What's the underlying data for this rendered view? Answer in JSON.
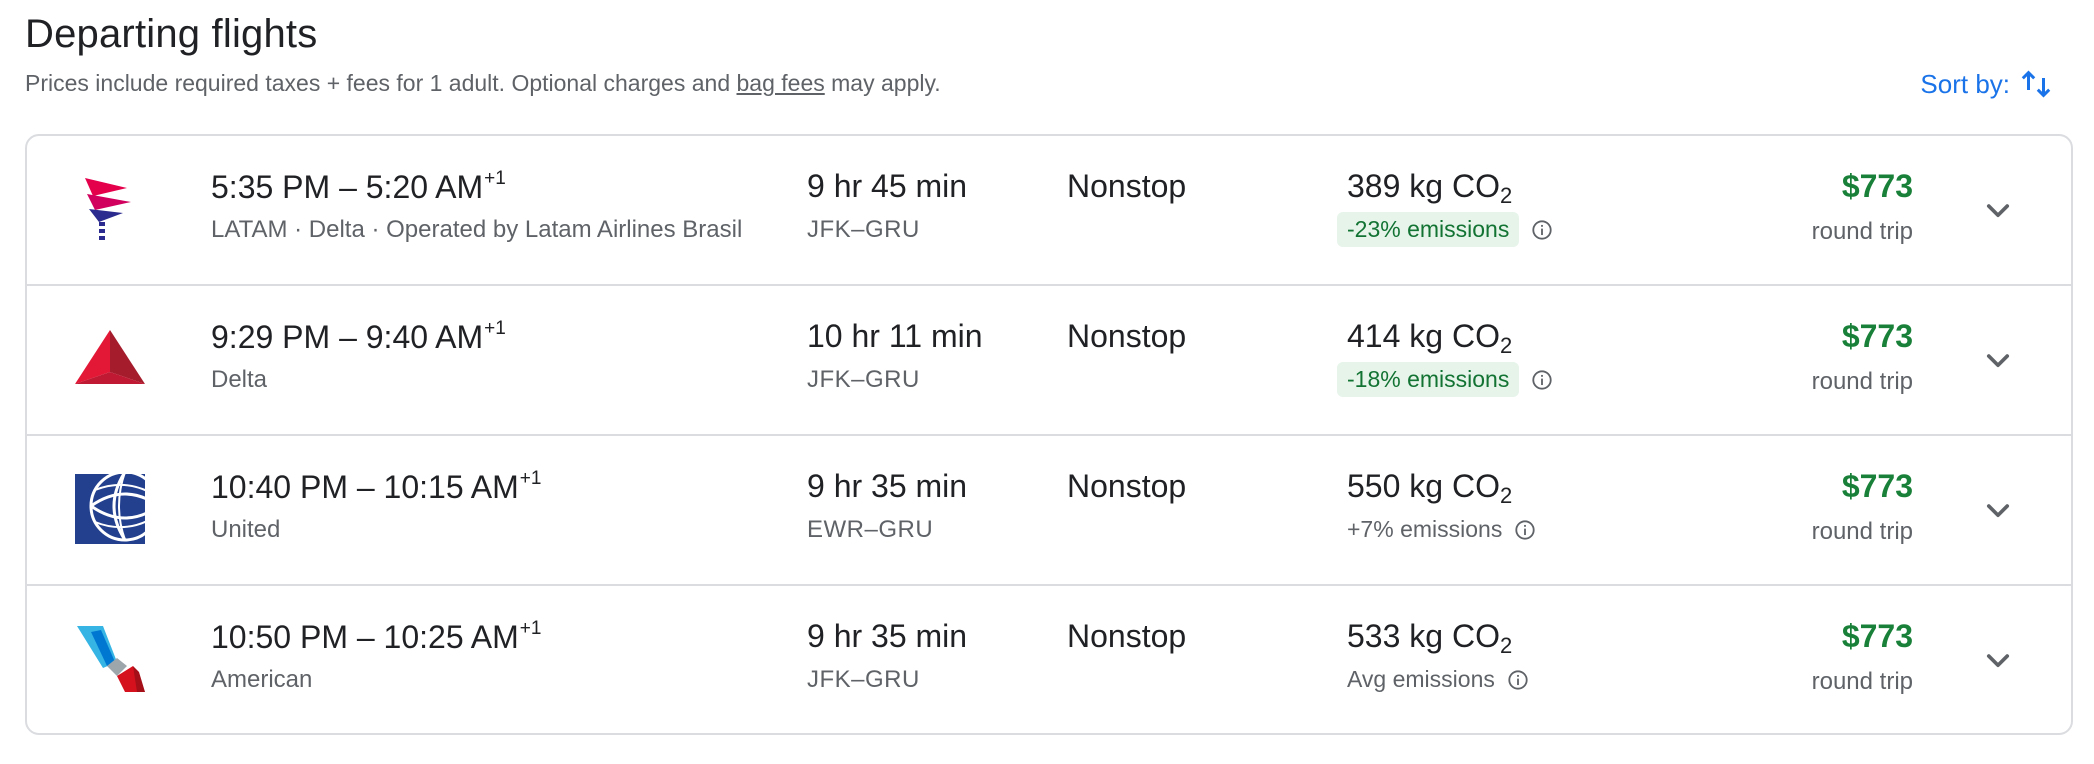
{
  "header": {
    "title": "Departing flights",
    "subtitle_prefix": "Prices include required taxes + fees for 1 adult. Optional charges and ",
    "subtitle_link": "bag fees",
    "subtitle_suffix": " may apply.",
    "sort_label": "Sort by:",
    "sort_icon": "swap-vert-icon"
  },
  "colors": {
    "accent_blue": "#1a73e8",
    "price_green": "#188038",
    "emission_badge_bg": "#e6f4ea",
    "emission_badge_text": "#137333",
    "border": "#dadce0"
  },
  "flights": [
    {
      "airline_logo": "latam-logo",
      "depart": "5:35 PM",
      "arrive": "5:20 AM",
      "day_offset": "+1",
      "airline": "LATAM · Delta · Operated by Latam Airlines Brasil",
      "duration": "9 hr 45 min",
      "route": "JFK–GRU",
      "stops": "Nonstop",
      "co2_value": "389 kg CO",
      "co2_sub": "2",
      "emissions": "-23% emissions",
      "emissions_style": "lower",
      "price": "$773",
      "price_label": "round trip"
    },
    {
      "airline_logo": "delta-logo",
      "depart": "9:29 PM",
      "arrive": "9:40 AM",
      "day_offset": "+1",
      "airline": "Delta",
      "duration": "10 hr 11 min",
      "route": "JFK–GRU",
      "stops": "Nonstop",
      "co2_value": "414 kg CO",
      "co2_sub": "2",
      "emissions": "-18% emissions",
      "emissions_style": "lower",
      "price": "$773",
      "price_label": "round trip"
    },
    {
      "airline_logo": "united-logo",
      "depart": "10:40 PM",
      "arrive": "10:15 AM",
      "day_offset": "+1",
      "airline": "United",
      "duration": "9 hr 35 min",
      "route": "EWR–GRU",
      "stops": "Nonstop",
      "co2_value": "550 kg CO",
      "co2_sub": "2",
      "emissions": "+7% emissions",
      "emissions_style": "plain",
      "price": "$773",
      "price_label": "round trip"
    },
    {
      "airline_logo": "american-logo",
      "depart": "10:50 PM",
      "arrive": "10:25 AM",
      "day_offset": "+1",
      "airline": "American",
      "duration": "9 hr 35 min",
      "route": "JFK–GRU",
      "stops": "Nonstop",
      "co2_value": "533 kg CO",
      "co2_sub": "2",
      "emissions": "Avg emissions",
      "emissions_style": "plain",
      "price": "$773",
      "price_label": "round trip"
    }
  ]
}
